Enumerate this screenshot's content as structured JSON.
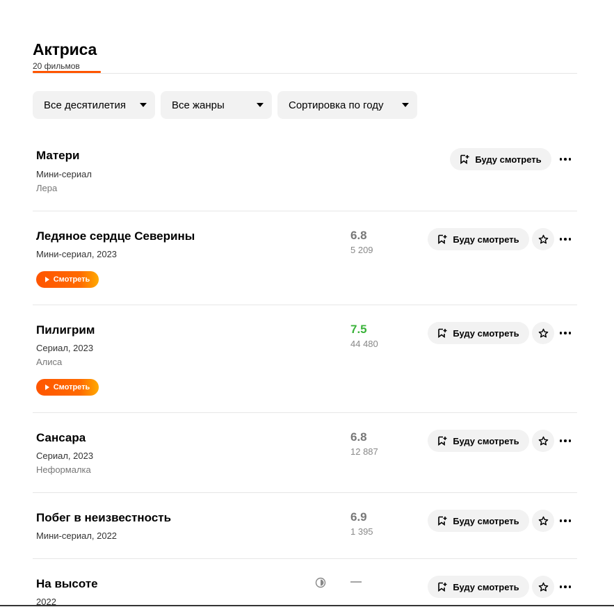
{
  "header": {
    "title": "Актриса",
    "count": "20 фильмов"
  },
  "filters": {
    "decades": "Все десятилетия",
    "genres": "Все жанры",
    "sort": "Сортировка по году"
  },
  "actions": {
    "want_label": "Буду смотреть",
    "watch_label": "Смотреть"
  },
  "items": [
    {
      "title": "Матери",
      "meta": "Мини-сериал",
      "role": "Лера",
      "rating": "",
      "votes": ""
    },
    {
      "title": "Ледяное сердце Северины",
      "meta": "Мини-сериал, 2023",
      "role": "",
      "rating": "6.8",
      "votes": "5 209"
    },
    {
      "title": "Пилигрим",
      "meta": "Сериал, 2023",
      "role": "Алиса",
      "rating": "7.5",
      "votes": "44 480"
    },
    {
      "title": "Сансара",
      "meta": "Сериал, 2023",
      "role": "Неформалка",
      "rating": "6.8",
      "votes": "12 887"
    },
    {
      "title": "Побег в неизвестность",
      "meta": "Мини-сериал, 2022",
      "role": "",
      "rating": "6.9",
      "votes": "1 395"
    },
    {
      "title": "На высоте",
      "meta": "2022",
      "role": "",
      "rating": "—",
      "votes": ""
    }
  ],
  "colors": {
    "accent": "#ff5500",
    "rating_good": "#3bb33b",
    "rating_neutral": "#777777"
  },
  "icons": {
    "bookmark": "bookmark-plus-icon",
    "star": "star-icon",
    "more": "more-dots-icon",
    "caret": "caret-down-icon",
    "play": "play-icon",
    "contrast": "contrast-icon"
  }
}
